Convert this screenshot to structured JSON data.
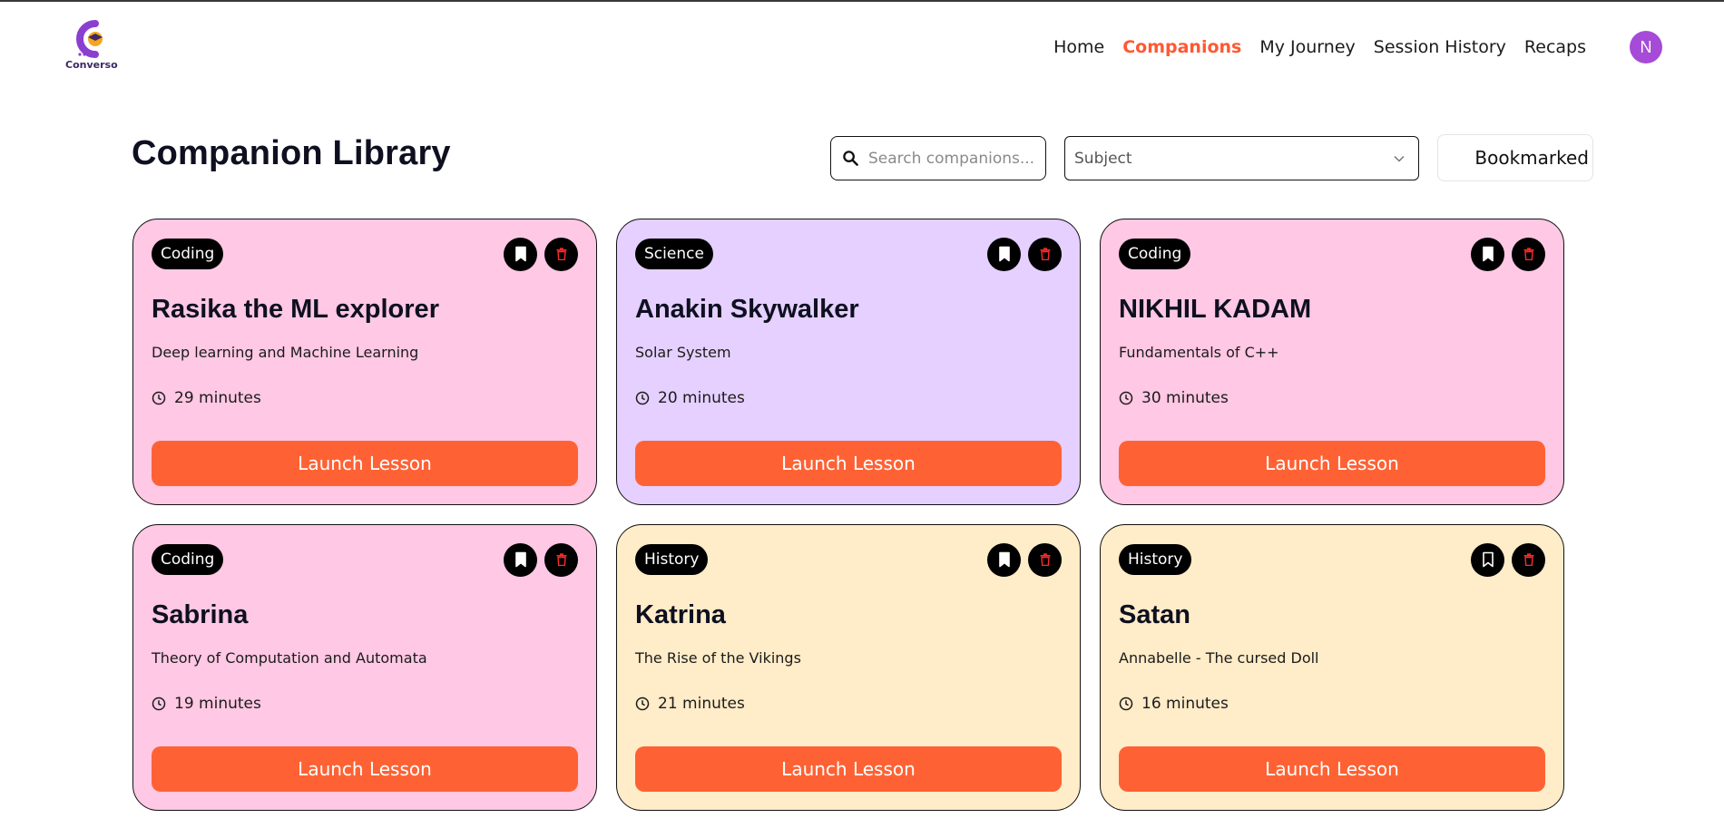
{
  "app": {
    "logo_text": "Converso"
  },
  "nav": {
    "links": [
      {
        "label": "Home",
        "active": false
      },
      {
        "label": "Companions",
        "active": true
      },
      {
        "label": "My Journey",
        "active": false
      },
      {
        "label": "Session History",
        "active": false
      },
      {
        "label": "Recaps",
        "active": false
      }
    ],
    "avatar_initial": "N"
  },
  "colors": {
    "accent": "#fe5933",
    "button": "#fe6234",
    "avatar": "#a64ad8",
    "coding_card": "#ffc8e4",
    "science_card": "#e5d0ff",
    "history_card": "#ffecc8"
  },
  "page": {
    "title": "Companion Library",
    "search_placeholder": "Search companions...",
    "subject_placeholder": "Subject",
    "bookmarked_label": "Bookmarked"
  },
  "companions": [
    {
      "subject": "Coding",
      "name": "Rasika the ML explorer",
      "topic": "Deep learning and Machine Learning",
      "duration": "29 minutes",
      "launch_label": "Launch Lesson",
      "bookmarked": true
    },
    {
      "subject": "Science",
      "name": "Anakin Skywalker",
      "topic": "Solar System",
      "duration": "20 minutes",
      "launch_label": "Launch Lesson",
      "bookmarked": true
    },
    {
      "subject": "Coding",
      "name": "NIKHIL KADAM",
      "topic": "Fundamentals of C++",
      "duration": "30 minutes",
      "launch_label": "Launch Lesson",
      "bookmarked": true
    },
    {
      "subject": "Coding",
      "name": "Sabrina",
      "topic": "Theory of Computation and Automata",
      "duration": "19 minutes",
      "launch_label": "Launch Lesson",
      "bookmarked": true
    },
    {
      "subject": "History",
      "name": "Katrina",
      "topic": "The Rise of the Vikings",
      "duration": "21 minutes",
      "launch_label": "Launch Lesson",
      "bookmarked": true
    },
    {
      "subject": "History",
      "name": "Satan",
      "topic": "Annabelle - The cursed Doll",
      "duration": "16 minutes",
      "launch_label": "Launch Lesson",
      "bookmarked": false
    }
  ],
  "icons": {
    "search": "search-icon",
    "chevron": "chevron-down-icon",
    "bookmark": "bookmark-icon",
    "trash": "trash-icon",
    "clock": "clock-icon"
  }
}
